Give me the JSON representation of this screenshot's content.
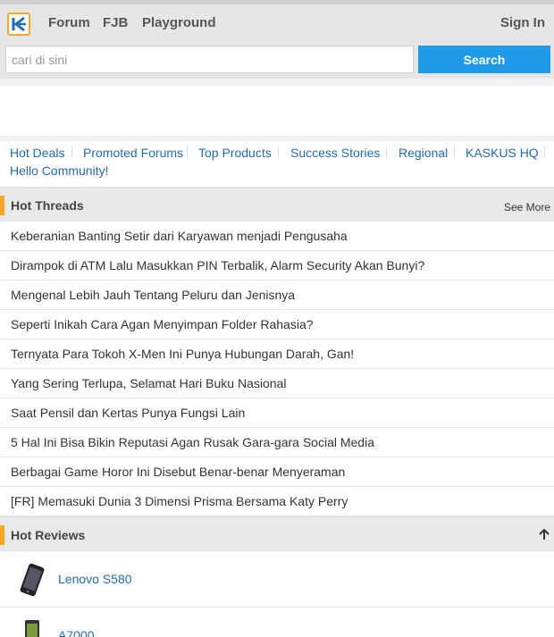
{
  "header": {
    "logo_icon": "kaskus-logo-icon",
    "nav": [
      "Forum",
      "FJB",
      "Playground"
    ],
    "sign_in": "Sign In"
  },
  "search": {
    "placeholder": "cari di sini",
    "value": "",
    "button": "Search"
  },
  "categories": [
    "Hot Deals",
    "Promoted Forums",
    "Top Products",
    "Success Stories",
    "Regional",
    "KASKUS HQ",
    "Hello Community!"
  ],
  "hot_threads": {
    "title": "Hot Threads",
    "see_more": "See More",
    "items": [
      "Keberanian Banting Setir dari Karyawan menjadi Pengusaha",
      "Dirampok di ATM Lalu Masukkan PIN Terbalik, Alarm Security Akan Bunyi?",
      "Mengenal Lebih Jauh Tentang Peluru dan Jenisnya",
      "Seperti Inikah Cara Agan Menyimpan Folder Rahasia?",
      "Ternyata Para Tokoh X-Men Ini Punya Hubungan Darah, Gan!",
      "Yang Sering Terlupa, Selamat Hari Buku Nasional",
      "Saat Pensil dan Kertas Punya Fungsi Lain",
      "5 Hal Ini Bisa Bikin Reputasi Agan Rusak Gara-gara Social Media",
      "Berbagai Game Horor Ini Disebut Benar-benar Menyeraman",
      "[FR] Memasuki Dunia 3 Dimensi Prisma Bersama Katy Perry"
    ]
  },
  "hot_reviews": {
    "title": "Hot Reviews",
    "collapse_icon": "arrow-up-icon",
    "items": [
      {
        "name": "Lenovo S580",
        "icon": "phone-thumbnail-icon"
      },
      {
        "name": "A7000",
        "icon": "phone-thumbnail-icon"
      }
    ]
  },
  "colors": {
    "accent": "#f5a623",
    "button": "#1e9be8",
    "link": "#1e6bb8"
  }
}
